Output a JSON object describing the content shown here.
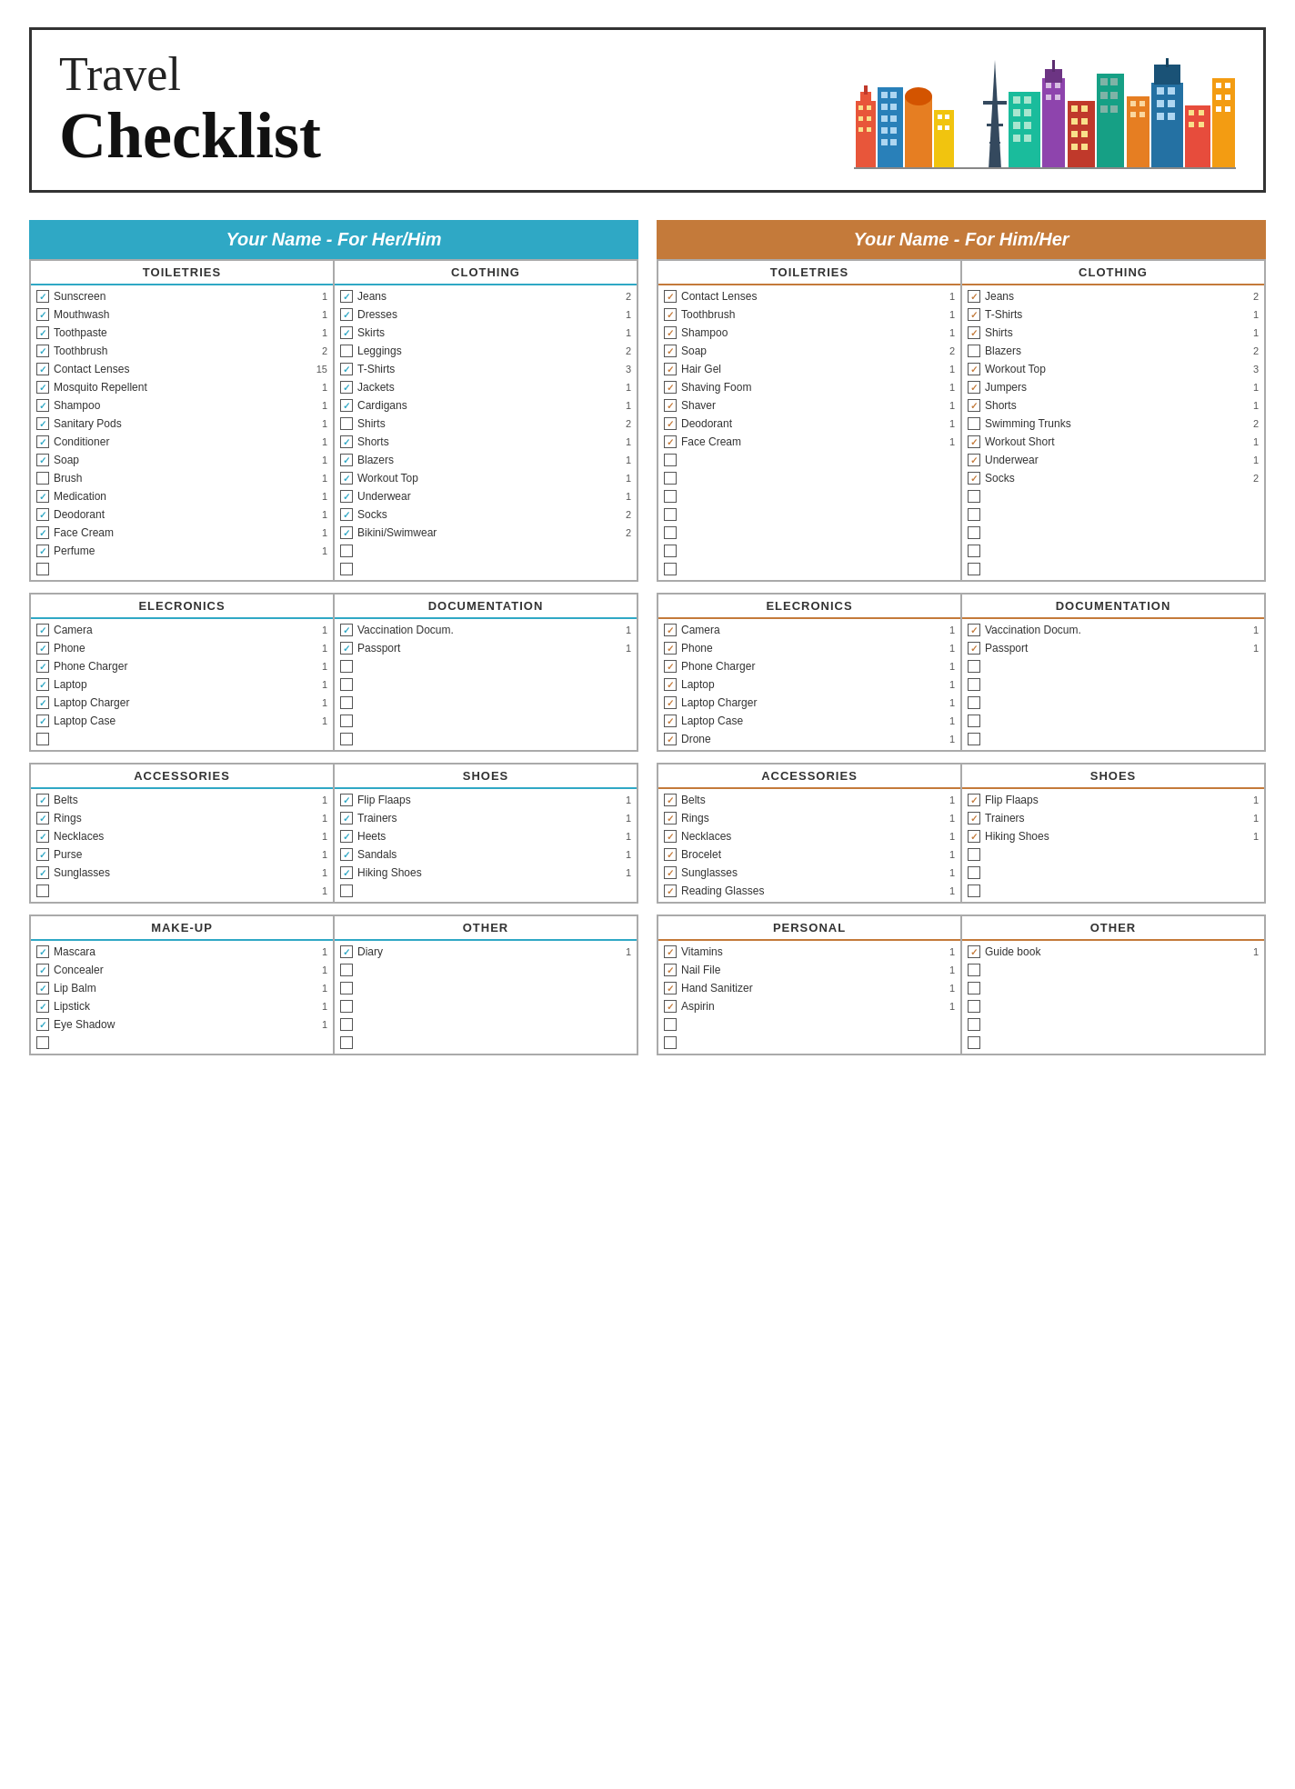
{
  "header": {
    "travel": "Travel",
    "checklist": "Checklist"
  },
  "her": {
    "title": "Your Name - For Her/Him",
    "toiletries": {
      "title": "TOILETRIES",
      "items": [
        {
          "name": "Sunscreen",
          "qty": "1",
          "checked": true
        },
        {
          "name": "Mouthwash",
          "qty": "1",
          "checked": true
        },
        {
          "name": "Toothpaste",
          "qty": "1",
          "checked": true
        },
        {
          "name": "Toothbrush",
          "qty": "2",
          "checked": true
        },
        {
          "name": "Contact Lenses",
          "qty": "15",
          "checked": true
        },
        {
          "name": "Mosquito Repellent",
          "qty": "1",
          "checked": true
        },
        {
          "name": "Shampoo",
          "qty": "1",
          "checked": true
        },
        {
          "name": "Sanitary Pods",
          "qty": "1",
          "checked": true
        },
        {
          "name": "Conditioner",
          "qty": "1",
          "checked": true
        },
        {
          "name": "Soap",
          "qty": "1",
          "checked": true
        },
        {
          "name": "Brush",
          "qty": "1",
          "checked": false
        },
        {
          "name": "Medication",
          "qty": "1",
          "checked": true
        },
        {
          "name": "Deodorant",
          "qty": "1",
          "checked": true
        },
        {
          "name": "Face Cream",
          "qty": "1",
          "checked": true
        },
        {
          "name": "Perfume",
          "qty": "1",
          "checked": true
        },
        {
          "name": "",
          "qty": "",
          "checked": false
        }
      ]
    },
    "clothing": {
      "title": "CLOTHING",
      "items": [
        {
          "name": "Jeans",
          "qty": "2",
          "checked": true
        },
        {
          "name": "Dresses",
          "qty": "1",
          "checked": true
        },
        {
          "name": "Skirts",
          "qty": "1",
          "checked": true
        },
        {
          "name": "Leggings",
          "qty": "2",
          "checked": false
        },
        {
          "name": "T-Shirts",
          "qty": "3",
          "checked": true
        },
        {
          "name": "Jackets",
          "qty": "1",
          "checked": true
        },
        {
          "name": "Cardigans",
          "qty": "1",
          "checked": true
        },
        {
          "name": "Shirts",
          "qty": "2",
          "checked": false
        },
        {
          "name": "Shorts",
          "qty": "1",
          "checked": true
        },
        {
          "name": "Blazers",
          "qty": "1",
          "checked": true
        },
        {
          "name": "Workout Top",
          "qty": "1",
          "checked": true
        },
        {
          "name": "Underwear",
          "qty": "1",
          "checked": true
        },
        {
          "name": "Socks",
          "qty": "2",
          "checked": true
        },
        {
          "name": "Bikini/Swimwear",
          "qty": "2",
          "checked": true
        },
        {
          "name": "",
          "qty": "",
          "checked": false
        },
        {
          "name": "",
          "qty": "",
          "checked": false
        }
      ]
    },
    "electronics": {
      "title": "ELECRONICS",
      "items": [
        {
          "name": "Camera",
          "qty": "1",
          "checked": true
        },
        {
          "name": "Phone",
          "qty": "1",
          "checked": true
        },
        {
          "name": "Phone Charger",
          "qty": "1",
          "checked": true
        },
        {
          "name": "Laptop",
          "qty": "1",
          "checked": true
        },
        {
          "name": "Laptop Charger",
          "qty": "1",
          "checked": true
        },
        {
          "name": "Laptop Case",
          "qty": "1",
          "checked": true
        },
        {
          "name": "",
          "qty": "",
          "checked": false
        }
      ]
    },
    "documentation": {
      "title": "DOCUMENTATION",
      "items": [
        {
          "name": "Vaccination Docum.",
          "qty": "1",
          "checked": true
        },
        {
          "name": "Passport",
          "qty": "1",
          "checked": true
        },
        {
          "name": "",
          "qty": "",
          "checked": false
        },
        {
          "name": "",
          "qty": "",
          "checked": false
        },
        {
          "name": "",
          "qty": "",
          "checked": false
        },
        {
          "name": "",
          "qty": "",
          "checked": false
        },
        {
          "name": "",
          "qty": "",
          "checked": false
        }
      ]
    },
    "accessories": {
      "title": "ACCESSORIES",
      "items": [
        {
          "name": "Belts",
          "qty": "1",
          "checked": true
        },
        {
          "name": "Rings",
          "qty": "1",
          "checked": true
        },
        {
          "name": "Necklaces",
          "qty": "1",
          "checked": true
        },
        {
          "name": "Purse",
          "qty": "1",
          "checked": true
        },
        {
          "name": "Sunglasses",
          "qty": "1",
          "checked": true
        },
        {
          "name": "",
          "qty": "1",
          "checked": false
        }
      ]
    },
    "shoes": {
      "title": "SHOES",
      "items": [
        {
          "name": "Flip Flaaps",
          "qty": "1",
          "checked": true
        },
        {
          "name": "Trainers",
          "qty": "1",
          "checked": true
        },
        {
          "name": "Heets",
          "qty": "1",
          "checked": true
        },
        {
          "name": "Sandals",
          "qty": "1",
          "checked": true
        },
        {
          "name": "Hiking Shoes",
          "qty": "1",
          "checked": true
        },
        {
          "name": "",
          "qty": "",
          "checked": false
        }
      ]
    },
    "makeup": {
      "title": "MAKE-UP",
      "items": [
        {
          "name": "Mascara",
          "qty": "1",
          "checked": true
        },
        {
          "name": "Concealer",
          "qty": "1",
          "checked": true
        },
        {
          "name": "Lip Balm",
          "qty": "1",
          "checked": true
        },
        {
          "name": "Lipstick",
          "qty": "1",
          "checked": true
        },
        {
          "name": "Eye Shadow",
          "qty": "1",
          "checked": true
        },
        {
          "name": "",
          "qty": "",
          "checked": false
        }
      ]
    },
    "other": {
      "title": "OTHER",
      "items": [
        {
          "name": "Diary",
          "qty": "1",
          "checked": true
        },
        {
          "name": "",
          "qty": "",
          "checked": false
        },
        {
          "name": "",
          "qty": "",
          "checked": false
        },
        {
          "name": "",
          "qty": "",
          "checked": false
        },
        {
          "name": "",
          "qty": "",
          "checked": false
        },
        {
          "name": "",
          "qty": "",
          "checked": false
        }
      ]
    }
  },
  "him": {
    "title": "Your Name - For Him/Her",
    "toiletries": {
      "title": "TOILETRIES",
      "items": [
        {
          "name": "Contact Lenses",
          "qty": "1",
          "checked": true
        },
        {
          "name": "Toothbrush",
          "qty": "1",
          "checked": true
        },
        {
          "name": "Shampoo",
          "qty": "1",
          "checked": true
        },
        {
          "name": "Soap",
          "qty": "2",
          "checked": true
        },
        {
          "name": "Hair Gel",
          "qty": "1",
          "checked": true
        },
        {
          "name": "Shaving Foom",
          "qty": "1",
          "checked": true
        },
        {
          "name": "Shaver",
          "qty": "1",
          "checked": true
        },
        {
          "name": "Deodorant",
          "qty": "1",
          "checked": true
        },
        {
          "name": "Face Cream",
          "qty": "1",
          "checked": true
        },
        {
          "name": "",
          "qty": "",
          "checked": false
        },
        {
          "name": "",
          "qty": "",
          "checked": false
        },
        {
          "name": "",
          "qty": "",
          "checked": false
        },
        {
          "name": "",
          "qty": "",
          "checked": false
        },
        {
          "name": "",
          "qty": "",
          "checked": false
        },
        {
          "name": "",
          "qty": "",
          "checked": false
        },
        {
          "name": "",
          "qty": "",
          "checked": false
        }
      ]
    },
    "clothing": {
      "title": "CLOTHING",
      "items": [
        {
          "name": "Jeans",
          "qty": "2",
          "checked": true
        },
        {
          "name": "T-Shirts",
          "qty": "1",
          "checked": true
        },
        {
          "name": "Shirts",
          "qty": "1",
          "checked": true
        },
        {
          "name": "Blazers",
          "qty": "2",
          "checked": false
        },
        {
          "name": "Workout Top",
          "qty": "3",
          "checked": true
        },
        {
          "name": "Jumpers",
          "qty": "1",
          "checked": true
        },
        {
          "name": "Shorts",
          "qty": "1",
          "checked": true
        },
        {
          "name": "Swimming Trunks",
          "qty": "2",
          "checked": false
        },
        {
          "name": "Workout Short",
          "qty": "1",
          "checked": true
        },
        {
          "name": "Underwear",
          "qty": "1",
          "checked": true
        },
        {
          "name": "Socks",
          "qty": "2",
          "checked": true
        },
        {
          "name": "",
          "qty": "",
          "checked": false
        },
        {
          "name": "",
          "qty": "",
          "checked": false
        },
        {
          "name": "",
          "qty": "",
          "checked": false
        },
        {
          "name": "",
          "qty": "",
          "checked": false
        },
        {
          "name": "",
          "qty": "",
          "checked": false
        }
      ]
    },
    "electronics": {
      "title": "ELECRONICS",
      "items": [
        {
          "name": "Camera",
          "qty": "1",
          "checked": true
        },
        {
          "name": "Phone",
          "qty": "1",
          "checked": true
        },
        {
          "name": "Phone Charger",
          "qty": "1",
          "checked": true
        },
        {
          "name": "Laptop",
          "qty": "1",
          "checked": true
        },
        {
          "name": "Laptop Charger",
          "qty": "1",
          "checked": true
        },
        {
          "name": "Laptop Case",
          "qty": "1",
          "checked": true
        },
        {
          "name": "Drone",
          "qty": "1",
          "checked": true
        }
      ]
    },
    "documentation": {
      "title": "DOCUMENTATION",
      "items": [
        {
          "name": "Vaccination Docum.",
          "qty": "1",
          "checked": true
        },
        {
          "name": "Passport",
          "qty": "1",
          "checked": true
        },
        {
          "name": "",
          "qty": "",
          "checked": false
        },
        {
          "name": "",
          "qty": "",
          "checked": false
        },
        {
          "name": "",
          "qty": "",
          "checked": false
        },
        {
          "name": "",
          "qty": "",
          "checked": false
        },
        {
          "name": "",
          "qty": "",
          "checked": false
        }
      ]
    },
    "accessories": {
      "title": "ACCESSORIES",
      "items": [
        {
          "name": "Belts",
          "qty": "1",
          "checked": true
        },
        {
          "name": "Rings",
          "qty": "1",
          "checked": true
        },
        {
          "name": "Necklaces",
          "qty": "1",
          "checked": true
        },
        {
          "name": "Brocelet",
          "qty": "1",
          "checked": true
        },
        {
          "name": "Sunglasses",
          "qty": "1",
          "checked": true
        },
        {
          "name": "Reading Glasses",
          "qty": "1",
          "checked": true
        }
      ]
    },
    "shoes": {
      "title": "SHOES",
      "items": [
        {
          "name": "Flip Flaaps",
          "qty": "1",
          "checked": true
        },
        {
          "name": "Trainers",
          "qty": "1",
          "checked": true
        },
        {
          "name": "Hiking Shoes",
          "qty": "1",
          "checked": true
        },
        {
          "name": "",
          "qty": "",
          "checked": false
        },
        {
          "name": "",
          "qty": "",
          "checked": false
        },
        {
          "name": "",
          "qty": "",
          "checked": false
        }
      ]
    },
    "personal": {
      "title": "PERSONAL",
      "items": [
        {
          "name": "Vitamins",
          "qty": "1",
          "checked": true
        },
        {
          "name": "Nail File",
          "qty": "1",
          "checked": true
        },
        {
          "name": "Hand Sanitizer",
          "qty": "1",
          "checked": true
        },
        {
          "name": "Aspirin",
          "qty": "1",
          "checked": true
        },
        {
          "name": "",
          "qty": "",
          "checked": false
        },
        {
          "name": "",
          "qty": "",
          "checked": false
        }
      ]
    },
    "other": {
      "title": "OTHER",
      "items": [
        {
          "name": "Guide book",
          "qty": "1",
          "checked": true
        },
        {
          "name": "",
          "qty": "",
          "checked": false
        },
        {
          "name": "",
          "qty": "",
          "checked": false
        },
        {
          "name": "",
          "qty": "",
          "checked": false
        },
        {
          "name": "",
          "qty": "",
          "checked": false
        },
        {
          "name": "",
          "qty": "",
          "checked": false
        }
      ]
    }
  }
}
